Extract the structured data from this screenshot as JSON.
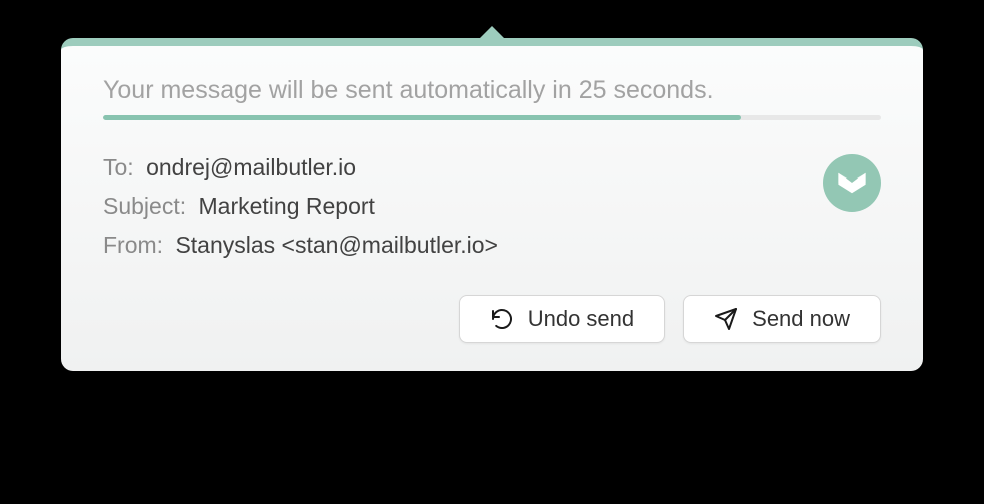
{
  "status": {
    "message": "Your message will be sent automatically in 25 seconds.",
    "seconds_remaining": 25,
    "progress_percent": 82
  },
  "email": {
    "to_label": "To:",
    "to_value": "ondrej@mailbutler.io",
    "subject_label": "Subject:",
    "subject_value": "Marketing Report",
    "from_label": "From:",
    "from_value": "Stanyslas <stan@mailbutler.io>"
  },
  "buttons": {
    "undo_label": "Undo send",
    "send_label": "Send now"
  },
  "icons": {
    "brand": "mailbutler-logo-icon",
    "undo": "refresh-ccw-icon",
    "send": "paper-plane-icon"
  },
  "colors": {
    "accent": "#93c7b4",
    "accent_border": "#9dccbd",
    "progress_fill": "#88c3af"
  }
}
